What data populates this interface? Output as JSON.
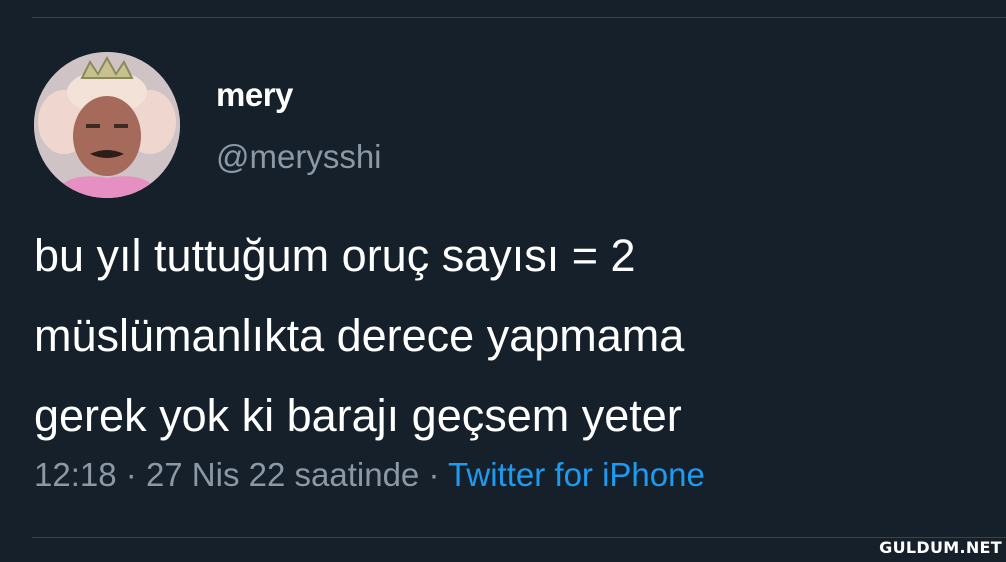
{
  "tweet": {
    "author": {
      "display_name": "mery",
      "handle": "@merysshi",
      "avatar_icon": "profile-photo-icon"
    },
    "text_lines": [
      "bu yıl tuttuğum oruç sayısı = 2",
      "müslümanlıkta derece yapmama",
      "gerek yok ki barajı geçsem yeter"
    ],
    "time": "12:18",
    "separator": "·",
    "date": "27 Nis 22 saatinde",
    "source": "Twitter for iPhone"
  },
  "watermark": "GULDUM.NET",
  "colors": {
    "background": "#15202b",
    "text": "#ffffff",
    "secondary": "#8b98a5",
    "link": "#1d9bf0",
    "divider": "#38444d"
  }
}
